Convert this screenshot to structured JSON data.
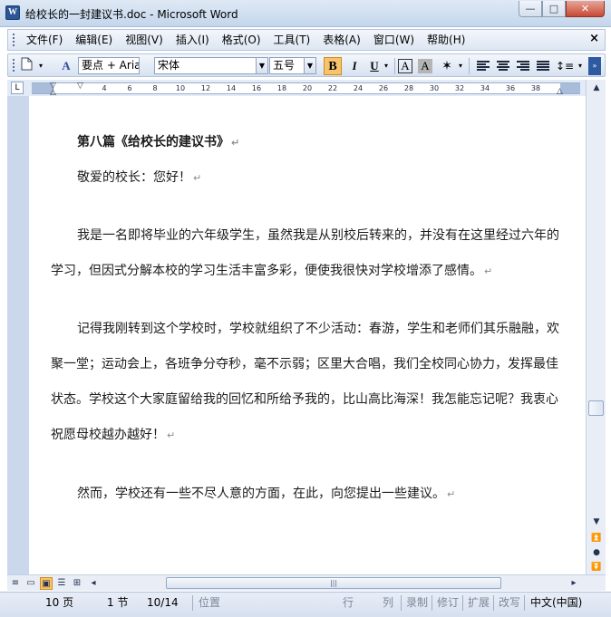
{
  "window": {
    "title": "给校长的一封建议书.doc - Microsoft Word",
    "app_icon": "word-doc-icon",
    "app_icon_letter": "W",
    "minimize": "—",
    "maximize": "□",
    "close": "✕"
  },
  "menu": {
    "items": [
      "文件(F)",
      "编辑(E)",
      "视图(V)",
      "插入(I)",
      "格式(O)",
      "工具(T)",
      "表格(A)",
      "窗口(W)",
      "帮助(H)"
    ],
    "close": "×"
  },
  "toolbar": {
    "style_value": "要点 + Aria",
    "font_value": "宋体",
    "size_value": "五号",
    "bold": "B",
    "italic": "I",
    "underline": "U",
    "char_border": "A",
    "char_shading": "A",
    "highlight_color": "#f8c46b"
  },
  "ruler": {
    "numbers": [
      "4",
      "6",
      "8",
      "10",
      "12",
      "14",
      "16",
      "18",
      "20",
      "22",
      "24",
      "26",
      "28",
      "30",
      "32",
      "34",
      "36",
      "38"
    ],
    "tab_selector": "L"
  },
  "document": {
    "heading": "第八篇《给校长的建议书》",
    "greeting": "敬爱的校长：您好！",
    "p1_line1": "我是一名即将毕业的六年级学生，虽然我是从别校后转来的，并没有在这里经过六年的",
    "p1_line2": "学习，但因式分解本校的学习生活丰富多彩，便使我很快对学校增添了感情。",
    "p2_line1": "记得我刚转到这个学校时，学校就组织了不少活动：春游，学生和老师们其乐融融，欢",
    "p2_line2": "聚一堂；运动会上，各班争分夺秒，毫不示弱；区里大合唱，我们全校同心协力，发挥最佳",
    "p2_line3": "状态。学校这个大家庭留给我的回忆和所给予我的，比山高比海深！我怎能忘记呢？我衷心",
    "p2_line4": "祝愿母校越办越好！",
    "p3_line1": "然而，学校还有一些不尽人意的方面，在此，向您提出一些建议。",
    "paragraph_mark": "↵"
  },
  "statusbar": {
    "page": "10 页",
    "section": "1 节",
    "pages": "10/14",
    "position": "位置",
    "line": "行",
    "column": "列",
    "record": "录制",
    "revise": "修订",
    "extend": "扩展",
    "overtype": "改写",
    "language": "中文(中国)"
  }
}
